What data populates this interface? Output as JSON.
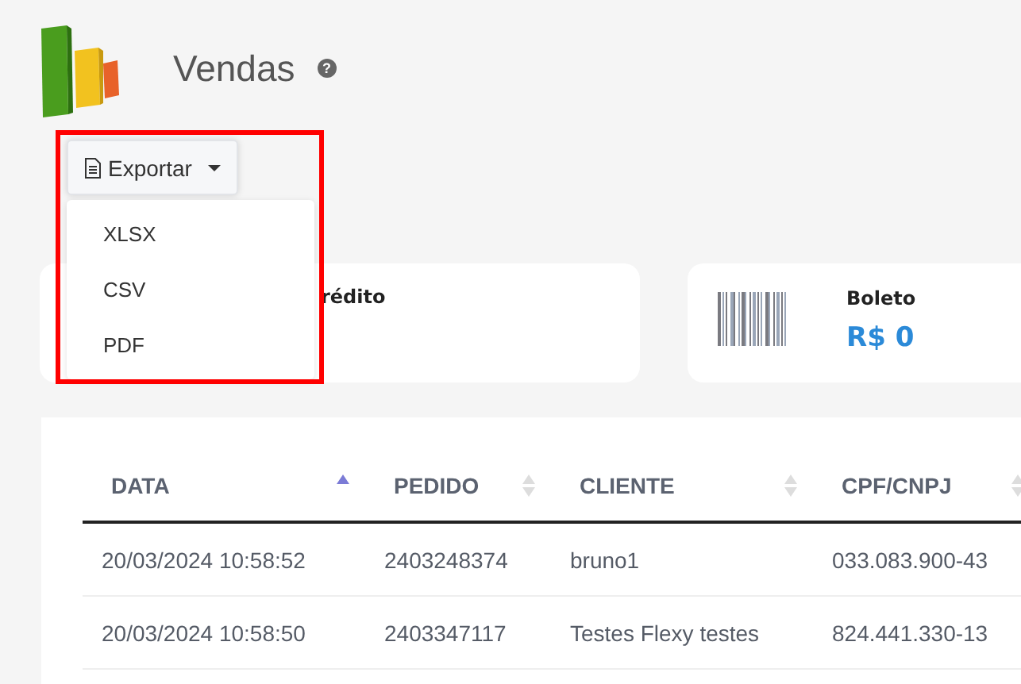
{
  "page": {
    "title": "Vendas",
    "help": "?"
  },
  "export": {
    "label": "Exportar",
    "expanded": true,
    "options": [
      "XLSX",
      "CSV",
      "PDF"
    ]
  },
  "cards": [
    {
      "kind": "credit",
      "label": "rédito"
    },
    {
      "kind": "boleto",
      "label": "Boleto",
      "value": "R$ 0"
    }
  ],
  "table": {
    "columns": [
      {
        "label": "DATA",
        "sorted": true
      },
      {
        "label": "PEDIDO",
        "sorted": false
      },
      {
        "label": "CLIENTE",
        "sorted": false
      },
      {
        "label": "CPF/CNPJ",
        "sorted": false
      }
    ],
    "rows": [
      [
        "20/03/2024 10:58:52",
        "2403248374",
        "bruno1",
        "033.083.900-43"
      ],
      [
        "20/03/2024 10:58:50",
        "2403347117",
        "Testes Flexy testes",
        "824.441.330-13"
      ]
    ]
  }
}
